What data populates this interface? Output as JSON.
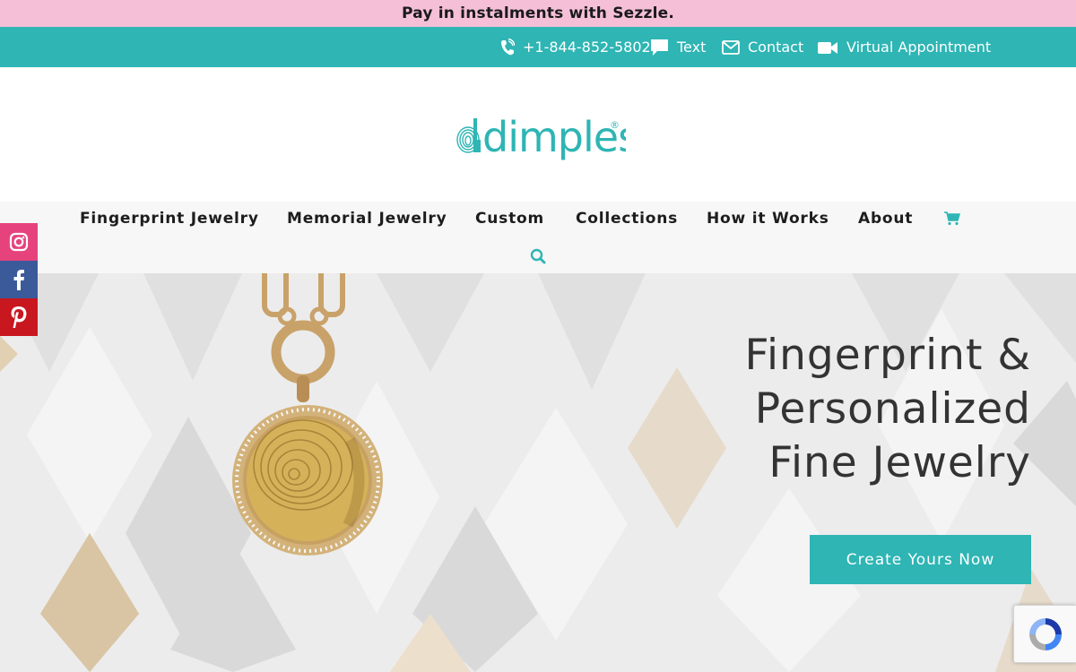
{
  "promo": {
    "text": "Pay in instalments with Sezzle."
  },
  "contact_bar": {
    "items": [
      {
        "label": "+1-844-852-5802",
        "icon": "phone-icon"
      },
      {
        "label": "Text",
        "icon": "chat-bubble-icon"
      },
      {
        "label": "Contact",
        "icon": "envelope-icon"
      },
      {
        "label": "Virtual Appointment",
        "icon": "video-camera-icon"
      }
    ]
  },
  "logo": {
    "text": "dimples",
    "mark": "®"
  },
  "nav": {
    "items": [
      {
        "label": "Fingerprint Jewelry"
      },
      {
        "label": "Memorial Jewelry"
      },
      {
        "label": "Custom"
      },
      {
        "label": "Collections"
      },
      {
        "label": "How it Works"
      },
      {
        "label": "About"
      }
    ],
    "cart_icon": "shopping-cart-icon",
    "search_icon": "search-icon"
  },
  "hero": {
    "headline": [
      "Fingerprint &",
      "Personalized",
      "Fine Jewelry"
    ],
    "cta_label": "Create Yours Now"
  },
  "social": [
    {
      "icon": "instagram-icon",
      "color": "#e6437d"
    },
    {
      "icon": "facebook-icon",
      "color": "#3b5a9a"
    },
    {
      "icon": "pinterest-icon",
      "color": "#c8171f"
    }
  ],
  "colors": {
    "brand_teal": "#2eb5b4",
    "promo_pink": "#f5bfd8",
    "heading": "#333333"
  }
}
